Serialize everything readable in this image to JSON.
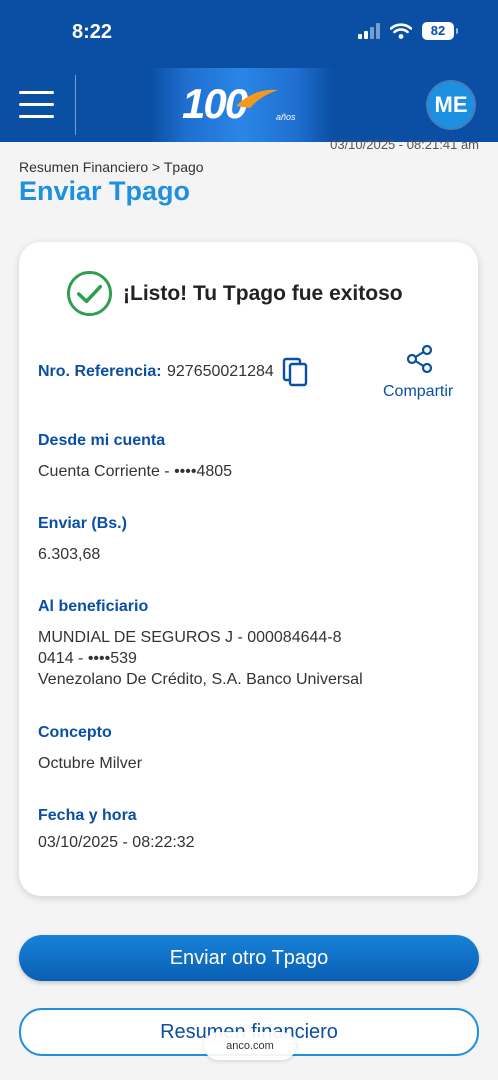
{
  "status_bar": {
    "time": "8:22",
    "battery": "82"
  },
  "header": {
    "logo_text": "100",
    "logo_sub": "años",
    "avatar_initials": "ME"
  },
  "timestamp": "03/10/2025 - 08:21:41 am",
  "breadcrumb": "Resumen Financiero > Tpago",
  "page_title": "Enviar Tpago",
  "card": {
    "success_title": "¡Listo! Tu Tpago fue exitoso",
    "reference_label": "Nro. Referencia:",
    "reference_value": "927650021284",
    "share_label": "Compartir",
    "from_label": "Desde mi cuenta",
    "from_value": "Cuenta Corriente - ••••4805",
    "amount_label": "Enviar (Bs.)",
    "amount_value": "6.303,68",
    "beneficiary_label": "Al beneficiario",
    "beneficiary_line1": "MUNDIAL DE SEGUROS J - 000084644-8",
    "beneficiary_line2": "0414 - ••••539",
    "beneficiary_line3": "Venezolano De Crédito, S.A. Banco Universal",
    "concept_label": "Concepto",
    "concept_value": "Octubre Milver",
    "datetime_label": "Fecha y hora",
    "datetime_value": "03/10/2025 - 08:22:32"
  },
  "buttons": {
    "send_another": "Enviar otro Tpago",
    "financial_summary": "Resumen financiero"
  },
  "url_bar": "anco.com",
  "colors": {
    "brand_blue": "#0a4fa3",
    "accent_blue": "#1e90e0",
    "success_green": "#2e9e4f"
  }
}
